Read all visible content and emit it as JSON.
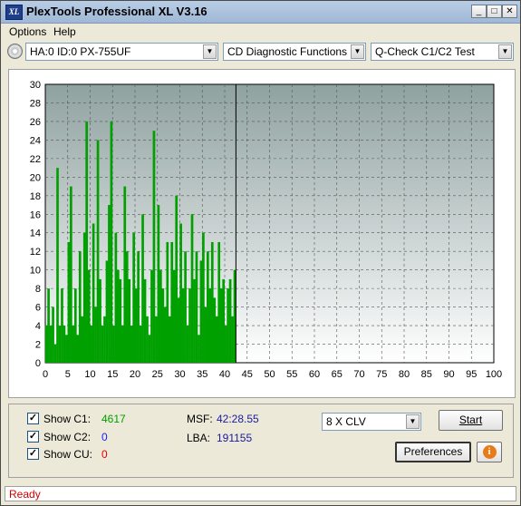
{
  "window": {
    "title": "PlexTools Professional XL V3.16",
    "app_icon_text": "XL"
  },
  "menu": {
    "options": "Options",
    "help": "Help"
  },
  "toolbar": {
    "drive": "HA:0 ID:0  PX-755UF",
    "function": "CD Diagnostic Functions",
    "test": "Q-Check C1/C2 Test"
  },
  "chart_data": {
    "type": "bar",
    "xlim": [
      0,
      100
    ],
    "ylim": [
      0,
      30
    ],
    "x_ticks": [
      0,
      5,
      10,
      15,
      20,
      25,
      30,
      35,
      40,
      45,
      50,
      55,
      60,
      65,
      70,
      75,
      80,
      85,
      90,
      95,
      100
    ],
    "y_ticks": [
      0,
      2,
      4,
      6,
      8,
      10,
      12,
      14,
      16,
      18,
      20,
      22,
      24,
      26,
      28,
      30
    ],
    "grid": true,
    "position_marker_x": 42.5,
    "series": [
      {
        "color": "#00a000",
        "x": [
          0.5,
          1,
          1.5,
          2,
          2.5,
          3,
          3.5,
          4,
          4.5,
          5,
          5.5,
          6,
          6.5,
          7,
          7.5,
          8,
          8.5,
          9,
          9.5,
          10,
          10.5,
          11,
          11.5,
          12,
          12.5,
          13,
          13.5,
          14,
          14.5,
          15,
          15.5,
          16,
          16.5,
          17,
          17.5,
          18,
          18.5,
          19,
          19.5,
          20,
          20.5,
          21,
          21.5,
          22,
          22.5,
          23,
          23.5,
          24,
          24.5,
          25,
          25.5,
          26,
          26.5,
          27,
          27.5,
          28,
          28.5,
          29,
          29.5,
          30,
          30.5,
          31,
          31.5,
          32,
          32.5,
          33,
          33.5,
          34,
          34.5,
          35,
          35.5,
          36,
          36.5,
          37,
          37.5,
          38,
          38.5,
          39,
          39.5,
          40,
          40.5,
          41,
          41.5,
          42,
          42.5
        ],
        "values": [
          4,
          8,
          4,
          6,
          2,
          21,
          4,
          8,
          4,
          3,
          13,
          19,
          4,
          8,
          3,
          12,
          5,
          14,
          26,
          10,
          4,
          15,
          6,
          24,
          9,
          4,
          5,
          11,
          17,
          26,
          4,
          14,
          10,
          9,
          4,
          19,
          12,
          9,
          4,
          14,
          8,
          12,
          4,
          16,
          9,
          5,
          3,
          10,
          25,
          5,
          17,
          10,
          8,
          6,
          13,
          5,
          13,
          10,
          18,
          7,
          15,
          8,
          12,
          4,
          8,
          16,
          9,
          12,
          3,
          11,
          14,
          6,
          12,
          8,
          13,
          7,
          5,
          13,
          8,
          9,
          4,
          8,
          9,
          5,
          10
        ]
      }
    ]
  },
  "controls": {
    "show_c1": {
      "label": "Show C1:",
      "value": "4617",
      "checked": "✓",
      "color": "#00a000"
    },
    "show_c2": {
      "label": "Show C2:",
      "value": "0",
      "checked": "✓",
      "color": "#1a1aff"
    },
    "show_cu": {
      "label": "Show CU:",
      "value": "0",
      "checked": "✓",
      "color": "#e00000"
    },
    "msf": {
      "label": "MSF:",
      "value": "42:28.55"
    },
    "lba": {
      "label": "LBA:",
      "value": "191155"
    },
    "speed": {
      "selected": "8 X CLV"
    },
    "start_label": "Start",
    "preferences_label": "Preferences",
    "info_icon": "i"
  },
  "status": {
    "text": "Ready"
  }
}
